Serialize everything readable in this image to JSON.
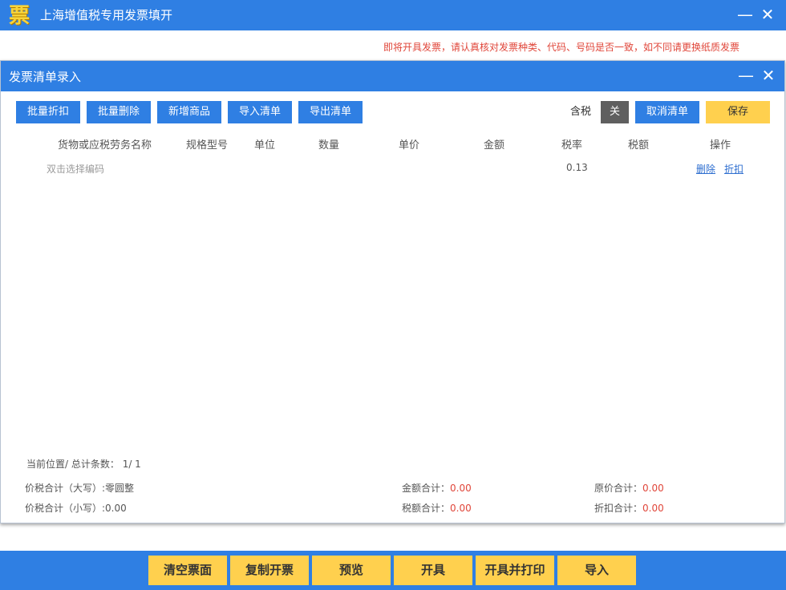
{
  "window": {
    "logo_char": "票",
    "title": "上海增值税专用发票填开",
    "minimize": "—",
    "close": "✕",
    "notice": "即将开具发票，请认真核对发票种类、代码、号码是否一致，如不同请更换纸质发票"
  },
  "dialog": {
    "title": "发票清单录入",
    "minimize": "—",
    "close": "✕"
  },
  "toolbar": {
    "batch_discount": "批量折扣",
    "batch_delete": "批量删除",
    "add_item": "新增商品",
    "import_list": "导入清单",
    "export_list": "导出清单",
    "tax_label": "含税",
    "tax_toggle": "关",
    "cancel_list": "取消清单",
    "save": "保存"
  },
  "table": {
    "headers": {
      "name": "货物或应税劳务名称",
      "spec": "规格型号",
      "unit": "单位",
      "qty": "数量",
      "price": "单价",
      "amount": "金额",
      "rate": "税率",
      "tax": "税额",
      "ops": "操作"
    },
    "rows": [
      {
        "name_placeholder": "双击选择编码",
        "rate": "0.13",
        "delete": "删除",
        "discount": "折扣"
      }
    ]
  },
  "footer": {
    "position_label": "当前位置/ 总计条数：",
    "position_value": "1/ 1",
    "total_upper_label": "价税合计（大写）:",
    "total_upper_value": "零圆整",
    "total_lower_label": "价税合计（小写）:",
    "total_lower_value": "0.00",
    "amount_label": "金额合计：",
    "amount_value": "0.00",
    "tax_label": "税额合计：",
    "tax_value": "0.00",
    "orig_label": "原价合计：",
    "orig_value": "0.00",
    "discount_label": "折扣合计：",
    "discount_value": "0.00"
  },
  "bottom": {
    "clear": "清空票面",
    "copy": "复制开票",
    "preview": "预览",
    "issue": "开具",
    "issue_print": "开具并打印",
    "import": "导入"
  }
}
